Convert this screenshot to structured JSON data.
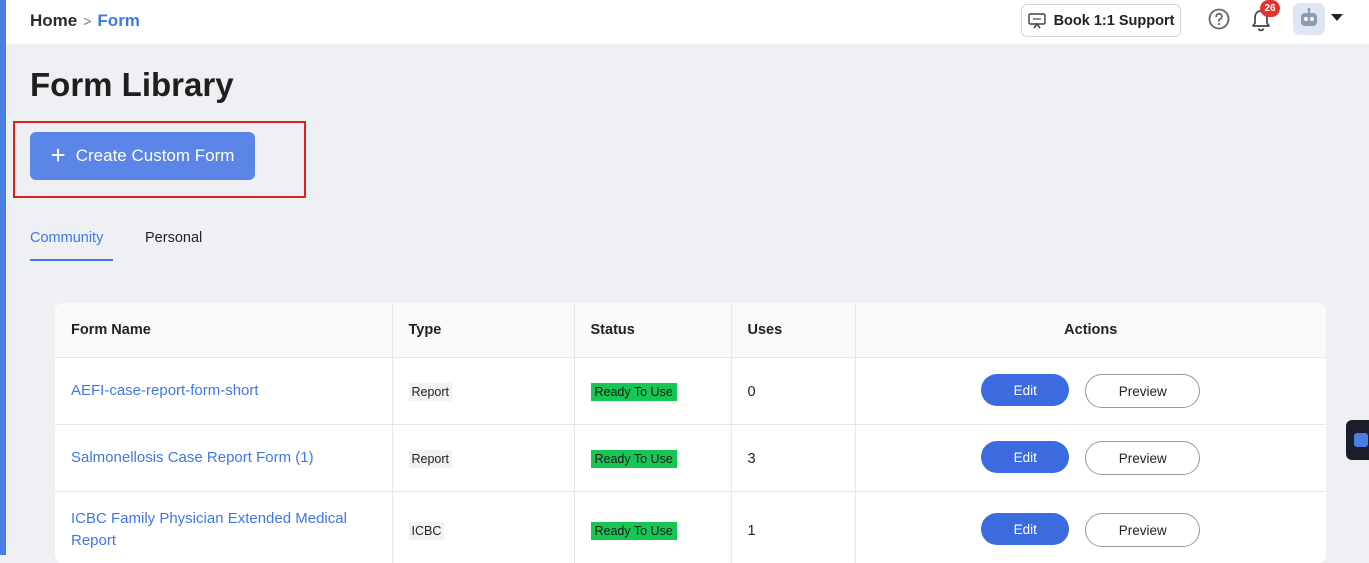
{
  "breadcrumb": {
    "home": "Home",
    "separator": ">",
    "current": "Form"
  },
  "header": {
    "support_label": "Book 1:1 Support",
    "notification_count": "26",
    "icons": [
      "monitor-chat-icon",
      "help-circle-icon",
      "bell-icon",
      "robot-avatar-icon",
      "caret-down-icon"
    ]
  },
  "page": {
    "title": "Form Library",
    "create_button_label": "Create Custom Form",
    "create_button_icon": "plus-icon"
  },
  "tabs": [
    {
      "label": "Community",
      "active": true
    },
    {
      "label": "Personal",
      "active": false
    }
  ],
  "table": {
    "columns": [
      "Form Name",
      "Type",
      "Status",
      "Uses",
      "Actions"
    ],
    "rows": [
      {
        "name": "AEFI-case-report-form-short",
        "type": "Report",
        "status": "Ready To Use",
        "uses": "0",
        "edit": "Edit",
        "preview": "Preview"
      },
      {
        "name": "Salmonellosis Case Report Form (1)",
        "type": "Report",
        "status": "Ready To Use",
        "uses": "3",
        "edit": "Edit",
        "preview": "Preview"
      },
      {
        "name": "ICBC Family Physician Extended Medical Report",
        "type": "ICBC",
        "status": "Ready To Use",
        "uses": "1",
        "edit": "Edit",
        "preview": "Preview"
      }
    ]
  },
  "colors": {
    "accent": "#3f78e0",
    "create_button": "#5b86e8",
    "status_ready": "#17c653",
    "highlight": "#e01f1f",
    "badge": "#e5322d"
  }
}
